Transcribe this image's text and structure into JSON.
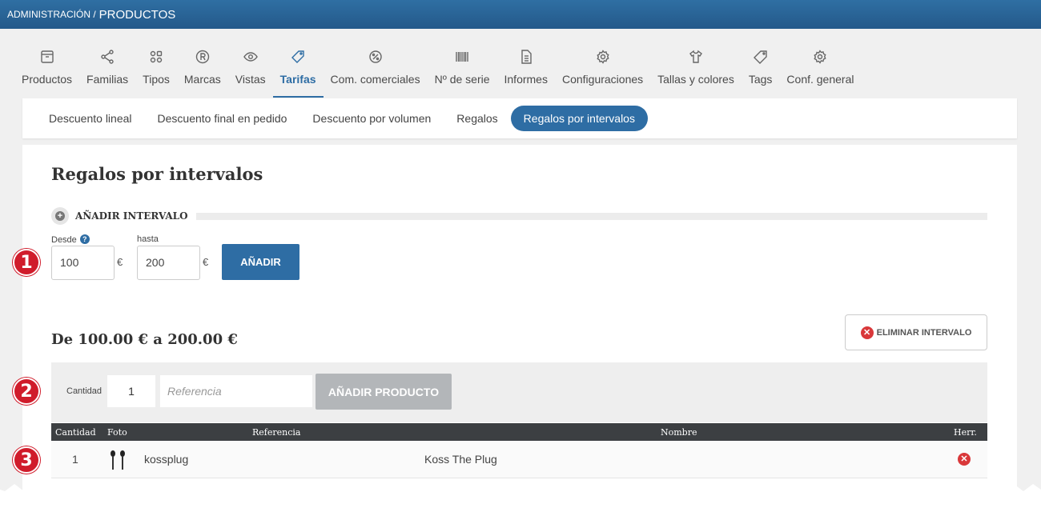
{
  "header": {
    "breadcrumb_parent": "ADMINISTRACIÓN /",
    "breadcrumb_current": "PRODUCTOS"
  },
  "nav": {
    "items": [
      {
        "label": "Productos",
        "icon": "archive-icon"
      },
      {
        "label": "Familias",
        "icon": "share-icon"
      },
      {
        "label": "Tipos",
        "icon": "shapes-icon"
      },
      {
        "label": "Marcas",
        "icon": "registered-icon"
      },
      {
        "label": "Vistas",
        "icon": "eye-icon"
      },
      {
        "label": "Tarifas",
        "icon": "tag-icon",
        "active": true
      },
      {
        "label": "Com. comerciales",
        "icon": "percent-badge-icon"
      },
      {
        "label": "Nº de serie",
        "icon": "barcode-icon"
      },
      {
        "label": "Informes",
        "icon": "document-icon"
      },
      {
        "label": "Configuraciones",
        "icon": "gear-icon"
      },
      {
        "label": "Tallas y colores",
        "icon": "tshirt-icon"
      },
      {
        "label": "Tags",
        "icon": "tags-icon"
      },
      {
        "label": "Conf. general",
        "icon": "gear-icon"
      }
    ]
  },
  "subtabs": {
    "items": [
      "Descuento lineal",
      "Descuento final en pedido",
      "Descuento por volumen",
      "Regalos",
      "Regalos por intervalos"
    ],
    "active": "Regalos por intervalos"
  },
  "page": {
    "title": "Regalos por intervalos"
  },
  "add_interval": {
    "section_label": "AÑADIR INTERVALO",
    "from_label": "Desde",
    "from_value": "100",
    "to_label": "hasta",
    "to_value": "200",
    "currency": "€",
    "add_button": "AÑADIR"
  },
  "interval": {
    "title": "De 100.00 € a 200.00 €",
    "delete_button": "ELIMINAR INTERVALO"
  },
  "add_product": {
    "quantity_label": "Cantidad",
    "quantity_value": "1",
    "reference_placeholder": "Referencia",
    "add_button": "AÑADIR PRODUCTO"
  },
  "table": {
    "columns": [
      "Cantidad",
      "Foto",
      "Referencia",
      "Nombre",
      "Herr."
    ],
    "rows": [
      {
        "cantidad": "1",
        "foto": "earbud-icon",
        "referencia": "kossplug",
        "nombre": "Koss The Plug"
      }
    ]
  },
  "markers": [
    "1",
    "2",
    "3"
  ],
  "colors": {
    "topbar": "#2b6497",
    "accent": "#2e6da4",
    "marker": "#d01c2b",
    "danger": "#d9383a",
    "table_header": "#3c3f42"
  }
}
